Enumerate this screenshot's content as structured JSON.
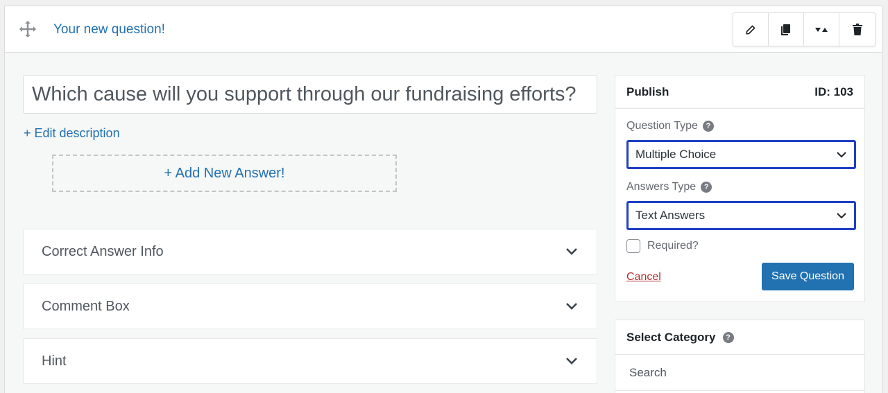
{
  "header": {
    "title": "Your new question!",
    "toolbar": {
      "edit_icon": "pencil-icon",
      "duplicate_icon": "copy-icon",
      "toggle_icon": "collapse-toggle-icon",
      "delete_icon": "trash-icon"
    }
  },
  "question": {
    "title": "Which cause will you support through our fundraising efforts?",
    "edit_description": "+ Edit description",
    "add_answer": "+ Add New Answer!"
  },
  "accordions": [
    {
      "label": "Correct Answer Info"
    },
    {
      "label": "Comment Box"
    },
    {
      "label": "Hint"
    }
  ],
  "publish": {
    "title": "Publish",
    "id_label": "ID: 103",
    "question_type_label": "Question Type",
    "question_type_value": "Multiple Choice",
    "answers_type_label": "Answers Type",
    "answers_type_value": "Text Answers",
    "required_label": "Required?",
    "cancel_label": "Cancel",
    "save_label": "Save Question"
  },
  "category": {
    "title": "Select Category",
    "search_placeholder": "Search"
  },
  "colors": {
    "accent": "#2271b1",
    "select_highlight": "#1f3fc4",
    "cancel": "#b32d2e"
  }
}
